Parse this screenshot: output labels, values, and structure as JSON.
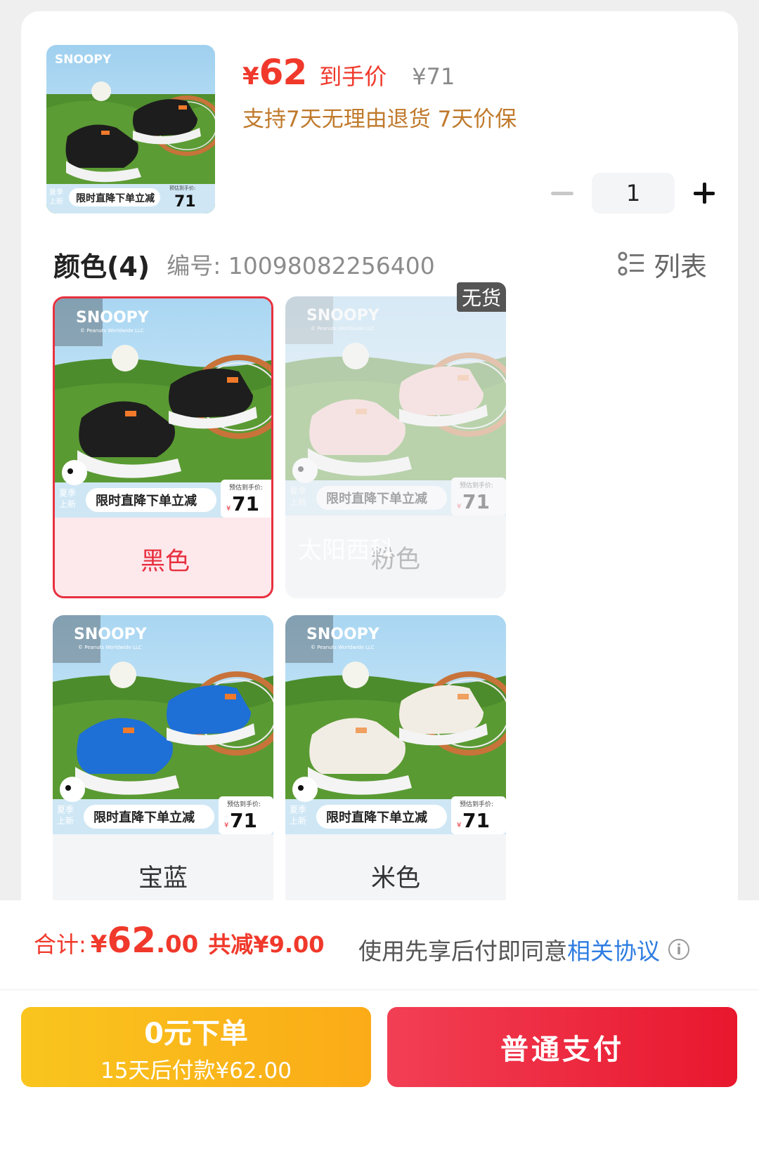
{
  "product": {
    "price_currency": "¥",
    "price": "62",
    "price_label": "到手价",
    "original_price": "¥71",
    "policy": "支持7天无理由退货 7天价保",
    "quantity": "1"
  },
  "thumbnail": {
    "brand": "SNOOPY",
    "promo": "限时直降下单立减",
    "season": "夏季上新",
    "est_label": "预估到手价:",
    "est_price": "71",
    "colors": {
      "shoe": "#1d1d1d",
      "accent": "#f07a2a"
    }
  },
  "section": {
    "title": "颜色(4)",
    "code": "编号: 10098082256400",
    "list_label": "列表"
  },
  "options": [
    {
      "name": "黑色",
      "state": "selected",
      "shoe_color": "#1e1e1e",
      "accent": "#f07a2a"
    },
    {
      "name": "粉色",
      "state": "out_of_stock",
      "badge": "无货",
      "shoe_color": "#f7c8c4",
      "accent": "#f4a26a"
    },
    {
      "name": "宝蓝",
      "state": "normal",
      "shoe_color": "#1e6fd6",
      "accent": "#f07a2a"
    },
    {
      "name": "米色",
      "state": "normal",
      "shoe_color": "#f2ede4",
      "accent": "#f0a060"
    }
  ],
  "card_image": {
    "brand": "SNOOPY",
    "license": "© Peanuts Worldwide LLC",
    "promo": "限时直降下单立减",
    "season": "夏季上新",
    "est_label": "预估到手价:",
    "est_currency": "¥",
    "est_price": "71"
  },
  "watermark": "太阳西科",
  "footer": {
    "total_label": "合计:",
    "total_currency": "¥",
    "total_int": "62",
    "total_dec": ".00",
    "saving": "共减¥9.00",
    "agree_text": "使用先享后付即同意",
    "agree_link": "相关协议",
    "info_icon": "i"
  },
  "buttons": {
    "later_main": "0元下单",
    "later_sub": "15天后付款¥62.00",
    "pay": "普通支付"
  }
}
